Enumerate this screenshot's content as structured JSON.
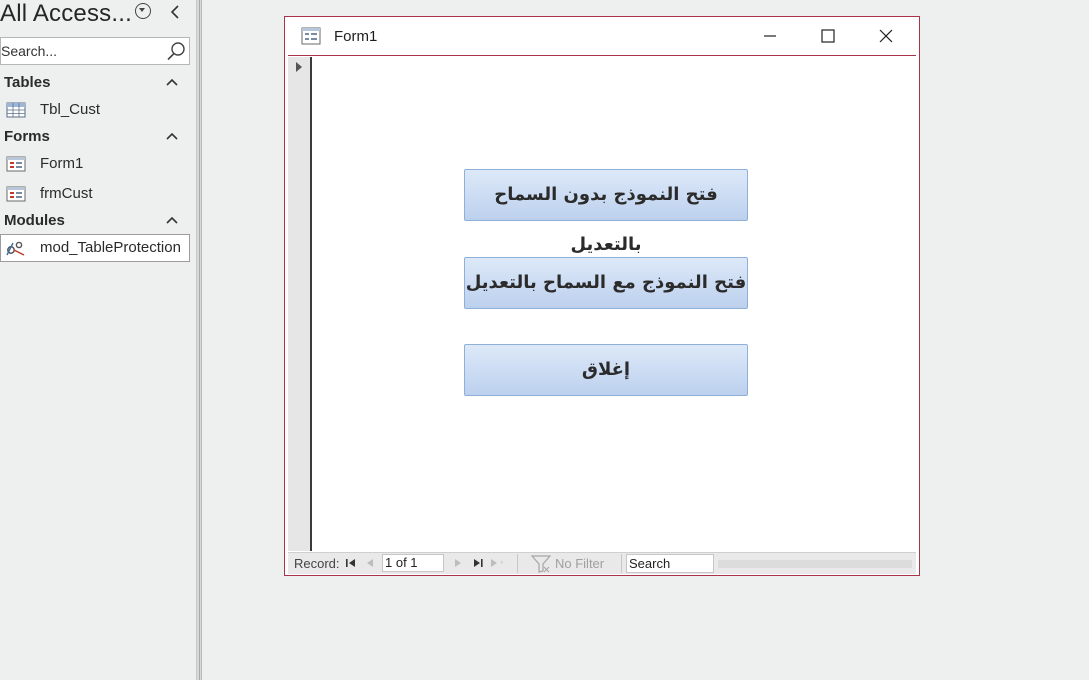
{
  "nav_pane": {
    "title": "All Access...",
    "search_placeholder": "Search...",
    "groups": [
      {
        "label": "Tables",
        "items": [
          {
            "label": "Tbl_Cust",
            "icon": "table-icon"
          }
        ]
      },
      {
        "label": "Forms",
        "items": [
          {
            "label": "Form1",
            "icon": "form-icon"
          },
          {
            "label": "frmCust",
            "icon": "form-icon"
          }
        ]
      },
      {
        "label": "Modules",
        "items": [
          {
            "label": "mod_TableProtection",
            "icon": "module-icon"
          }
        ]
      }
    ]
  },
  "form_window": {
    "title": "Form1",
    "buttons": [
      {
        "label": "فتح النموذج بدون السماح بالتعديل"
      },
      {
        "label": "فتح النموذج مع السماح بالتعديل"
      },
      {
        "label": "إغلاق"
      }
    ],
    "record_nav": {
      "label": "Record:",
      "count": "1 of 1",
      "filter_status": "No Filter",
      "search_value": "Search"
    }
  },
  "colors": {
    "window_border": "#a8334a",
    "button_gradient_top": "#dde9f8",
    "button_gradient_bottom": "#bcd0ee",
    "background": "#eef0ef"
  }
}
